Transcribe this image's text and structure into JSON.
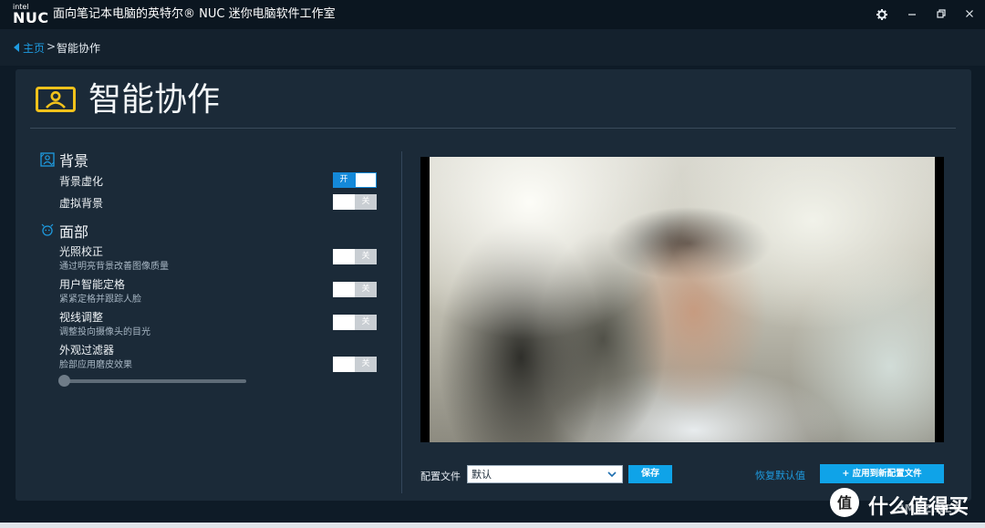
{
  "app": {
    "brand_small": "intel",
    "brand": "NUC",
    "title": "面向笔记本电脑的英特尔® NUC 迷你电脑软件工作室"
  },
  "window_controls": {
    "settings_icon": "gear-icon",
    "minimize_icon": "minimize-icon",
    "restore_icon": "restore-icon",
    "close_icon": "close-icon"
  },
  "breadcrumb": {
    "home": "主页",
    "separator": ">",
    "current": "智能协作"
  },
  "page": {
    "title": "智能协作",
    "icon": "user-frame-icon"
  },
  "sections": [
    {
      "title": "背景",
      "icon": "background-icon",
      "items": [
        {
          "label": "背景虚化",
          "toggle": {
            "on": true,
            "text": "开"
          }
        },
        {
          "label": "虚拟背景",
          "toggle": {
            "on": false,
            "text": "关"
          }
        }
      ]
    },
    {
      "title": "面部",
      "icon": "face-icon",
      "items": [
        {
          "label": "光照校正",
          "description": "通过明亮背景改善图像质量",
          "toggle": {
            "on": false,
            "text": "关"
          }
        },
        {
          "label": "用户智能定格",
          "description": "紧紧定格并跟踪人脸",
          "toggle": {
            "on": false,
            "text": "关"
          }
        },
        {
          "label": "视线调整",
          "description": "调整投向摄像头的目光",
          "toggle": {
            "on": false,
            "text": "关"
          }
        },
        {
          "label": "外观过滤器",
          "description": "脸部应用磨皮效果",
          "toggle": {
            "on": false,
            "text": "关"
          }
        }
      ]
    }
  ],
  "filter_slider": {
    "value": 0
  },
  "profile": {
    "label": "配置文件",
    "selected": "默认",
    "save": "保存",
    "restore_default": "恢复默认值",
    "apply_new": "+ 应用到新配置文件"
  },
  "watermark": {
    "text": "什么值得买",
    "sub": "SMYZ.NET"
  },
  "colors": {
    "accent": "#0fa3e8",
    "link": "#1e9be0",
    "panel": "#1b2a38",
    "background": "#0e1b27"
  }
}
